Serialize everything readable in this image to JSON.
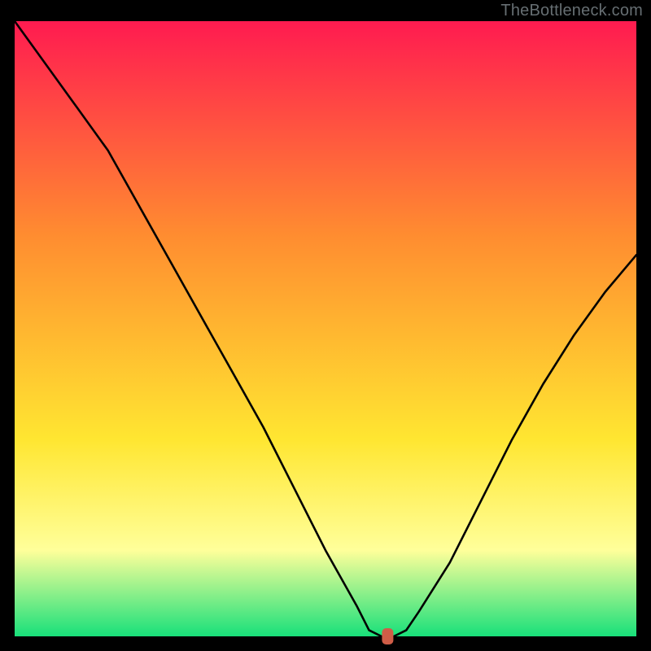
{
  "watermark": "TheBottleneck.com",
  "chart_data": {
    "type": "line",
    "title": "",
    "xlabel": "",
    "ylabel": "",
    "xlim": [
      0,
      100
    ],
    "ylim": [
      0,
      100
    ],
    "grid": false,
    "legend": false,
    "background_gradient": {
      "top": "#ff1b50",
      "mid1": "#ff8d30",
      "mid2": "#ffe631",
      "mid3": "#ffff9a",
      "bottom": "#18e07a"
    },
    "series": [
      {
        "name": "bottleneck-curve",
        "color": "#000000",
        "x": [
          0,
          5,
          10,
          15,
          20,
          25,
          30,
          35,
          40,
          45,
          50,
          55,
          57,
          59,
          61,
          63,
          65,
          70,
          75,
          80,
          85,
          90,
          95,
          100
        ],
        "y_bottleneck_pct": [
          100,
          93,
          86,
          79,
          70,
          61,
          52,
          43,
          34,
          24,
          14,
          5,
          1,
          0,
          0,
          1,
          4,
          12,
          22,
          32,
          41,
          49,
          56,
          62
        ]
      }
    ],
    "marker": {
      "name": "current-config",
      "x": 60,
      "y_bottleneck_pct": 0,
      "color": "#cf5d47"
    },
    "frame": {
      "color": "#000000",
      "inner_rect_fraction": 0.955
    }
  }
}
